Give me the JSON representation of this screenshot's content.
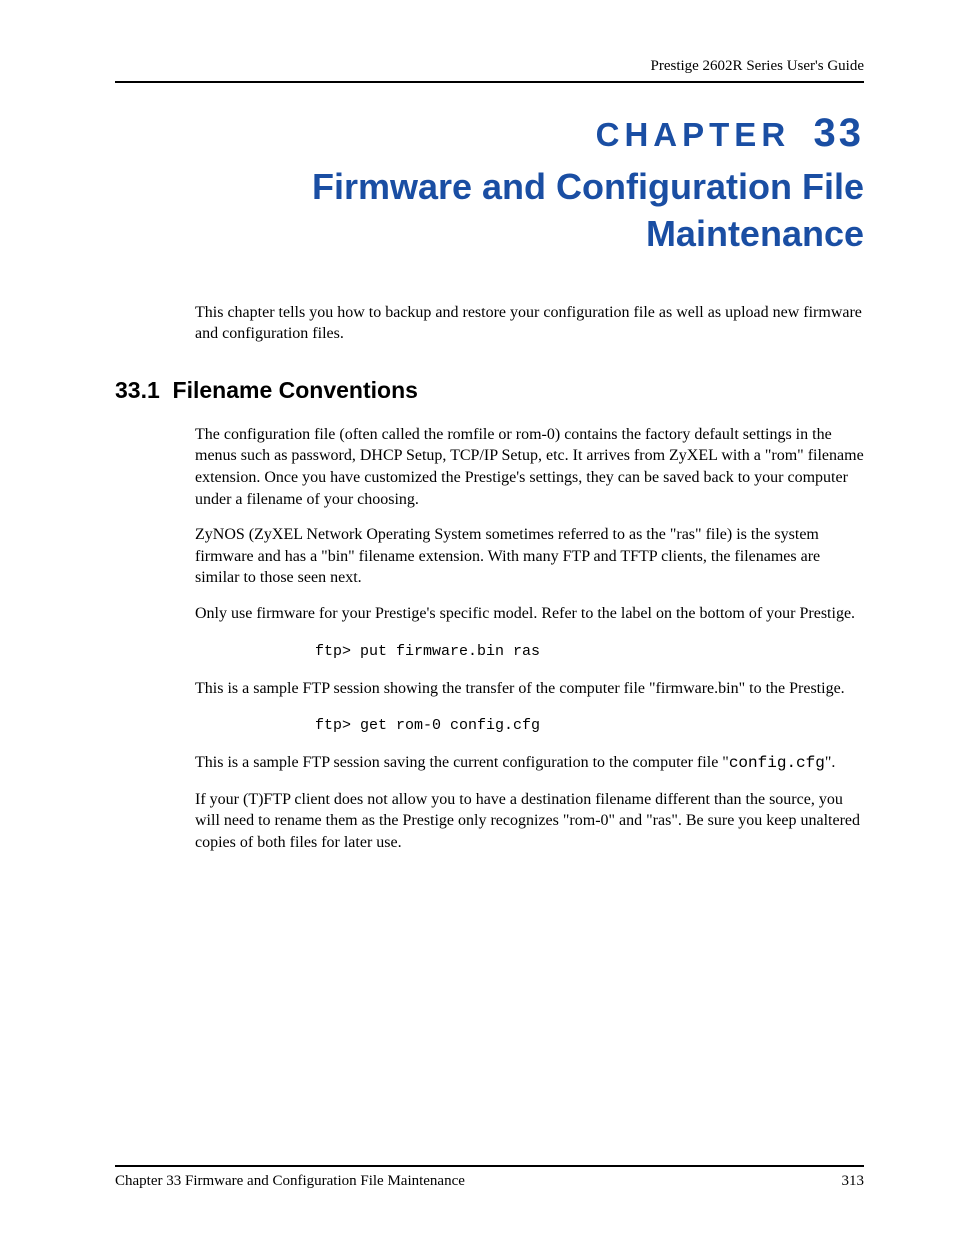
{
  "header": {
    "guide_title": "Prestige 2602R Series User's Guide"
  },
  "chapter": {
    "label_word": "CHAPTER",
    "number": "33",
    "title": "Firmware and Configuration File Maintenance"
  },
  "intro": "This chapter tells you how to backup and restore your configuration file as well as upload new firmware and configuration files.",
  "section": {
    "number": "33.1",
    "title": "Filename Conventions"
  },
  "paragraphs": {
    "p1": "The configuration file (often called the romfile or rom-0) contains the factory default settings in the menus such as password, DHCP Setup, TCP/IP Setup, etc. It arrives from ZyXEL with a \"rom\" filename extension. Once you have customized the Prestige's settings, they can be saved back to your computer under a filename of your choosing.",
    "p2": "ZyNOS (ZyXEL Network Operating System sometimes referred to as the \"ras\" file) is the system firmware and has a \"bin\" filename extension. With many FTP and TFTP clients, the filenames are similar to those seen next.",
    "p3": "Only use firmware for your Prestige's specific model. Refer to the label on the bottom of your Prestige.",
    "code1": "ftp> put firmware.bin ras",
    "p4": "This is a sample FTP session showing the transfer of the computer file \"firmware.bin\" to the Prestige.",
    "code2": "ftp> get rom-0 config.cfg",
    "p5_a": "This is a sample FTP session saving the current configuration to the computer file \"",
    "p5_code": "config.cfg",
    "p5_b": "\".",
    "p6": "If your (T)FTP client does not allow you to have a destination filename different than the source, you will need to rename them as the Prestige only recognizes \"rom-0\" and \"ras\". Be sure you keep unaltered copies of both files for later use."
  },
  "footer": {
    "chapter_ref": "Chapter 33 Firmware and Configuration File Maintenance",
    "page_number": "313"
  }
}
